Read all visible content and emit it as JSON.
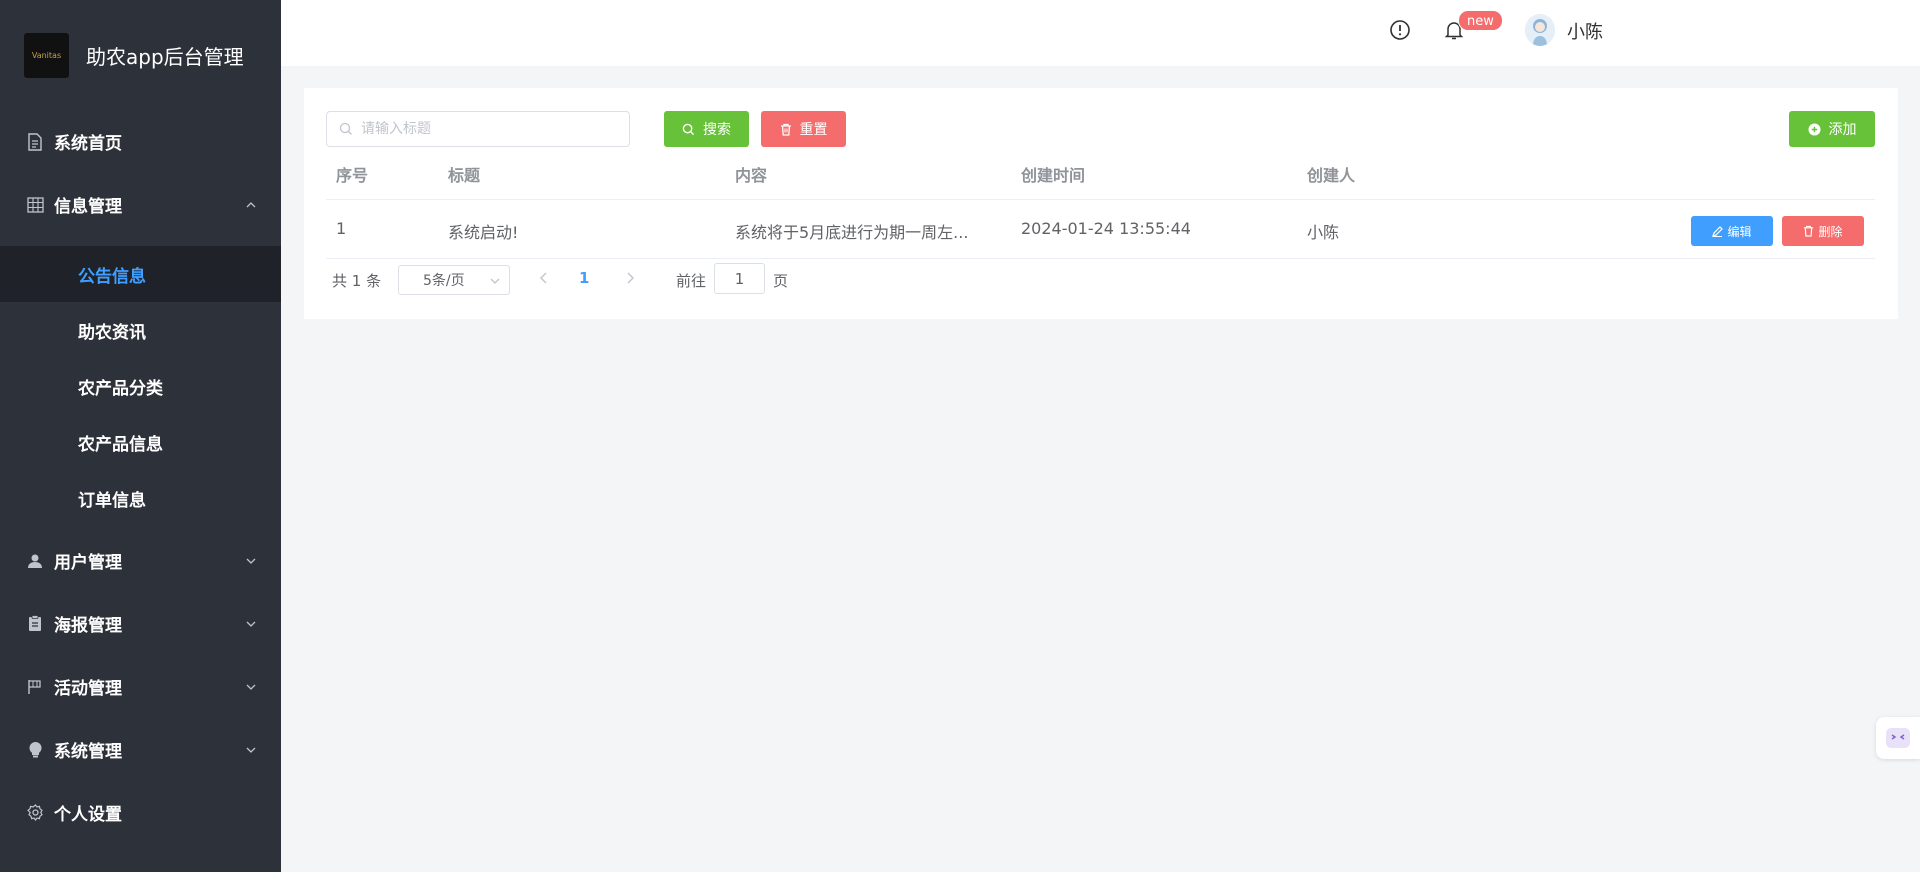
{
  "brand": {
    "title": "助农app后台管理",
    "logo_text": "Vanitas"
  },
  "sidebar": {
    "items": [
      {
        "label": "系统首页",
        "icon": "document-icon"
      },
      {
        "label": "信息管理",
        "icon": "grid-icon",
        "expanded": true,
        "children": [
          "公告信息",
          "助农资讯",
          "农产品分类",
          "农产品信息",
          "订单信息"
        ],
        "active_child": "公告信息"
      },
      {
        "label": "用户管理",
        "icon": "user-icon"
      },
      {
        "label": "海报管理",
        "icon": "clipboard-icon"
      },
      {
        "label": "活动管理",
        "icon": "flag-icon"
      },
      {
        "label": "系统管理",
        "icon": "bulb-icon"
      },
      {
        "label": "个人设置",
        "icon": "gear-icon"
      }
    ]
  },
  "header": {
    "badge": "new",
    "username": "小陈"
  },
  "toolbar": {
    "search_placeholder": "请输入标题",
    "search_label": "搜索",
    "reset_label": "重置",
    "add_label": "添加"
  },
  "table": {
    "columns": [
      "序号",
      "标题",
      "内容",
      "创建时间",
      "创建人"
    ],
    "rows": [
      {
        "index": "1",
        "title": "系统启动!",
        "content": "系统将于5月底进行为期一周左...",
        "created": "2024-01-24 13:55:44",
        "creator": "小陈",
        "edit_label": "编辑",
        "delete_label": "删除"
      }
    ]
  },
  "pagination": {
    "total_text": "共 1 条",
    "page_size": "5条/页",
    "current_page": "1",
    "goto_label": "前往",
    "goto_value": "1",
    "page_suffix": "页"
  },
  "colors": {
    "sidebar_bg": "#2d3139",
    "active_menu": "#409eff",
    "green": "#67c23a",
    "red": "#f56c6c",
    "blue": "#409eff"
  }
}
